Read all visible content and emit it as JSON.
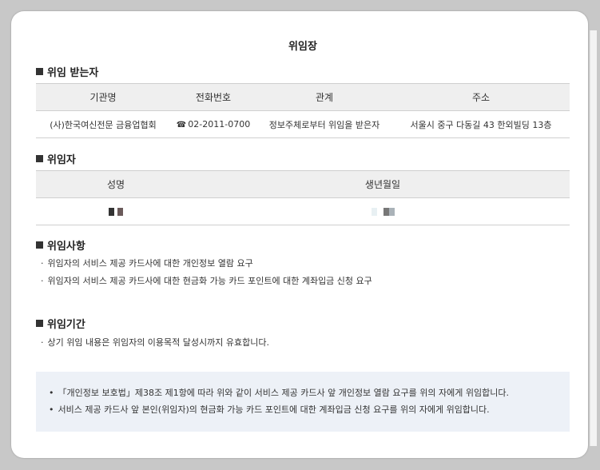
{
  "title": "위임장",
  "section_recipient": {
    "heading": "위임 받는자",
    "headers": [
      "기관명",
      "전화번호",
      "관계",
      "주소"
    ],
    "row": {
      "org": "(사)한국여신전문 금융업협회",
      "phone": "02-2011-0700",
      "relation": "정보주체로부터 위임을 받은자",
      "address": "서울시 중구 다동길 43 한외빌딩 13층"
    }
  },
  "section_delegator": {
    "heading": "위임자",
    "headers": [
      "성명",
      "생년월일"
    ]
  },
  "section_matters": {
    "heading": "위임사항",
    "items": [
      "위임자의 서비스 제공 카드사에 대한 개인정보 열람 요구",
      "위임자의 서비스 제공 카드사에 대한 현금화 가능 카드 포인트에 대한 계좌입금 신청 요구"
    ]
  },
  "section_period": {
    "heading": "위임기간",
    "items": [
      "상기 위임 내용은 위임자의 이용목적 달성시까지 유효합니다."
    ]
  },
  "notice": {
    "items": [
      "「개인정보 보호법」제38조 제1항에 따라 위와 같이 서비스 제공 카드사 앞 개인정보 열람 요구를 위의 자에게 위임합니다.",
      "서비스 제공 카드사 앞 본인(위임자)의 현금화 가능 카드 포인트에 대한 계좌입금 신청 요구를 위의 자에게 위임합니다."
    ]
  },
  "colors": {
    "page_bg": "#c8c8c8",
    "table_header_bg": "#efefef",
    "notice_bg": "#edf1f7"
  }
}
